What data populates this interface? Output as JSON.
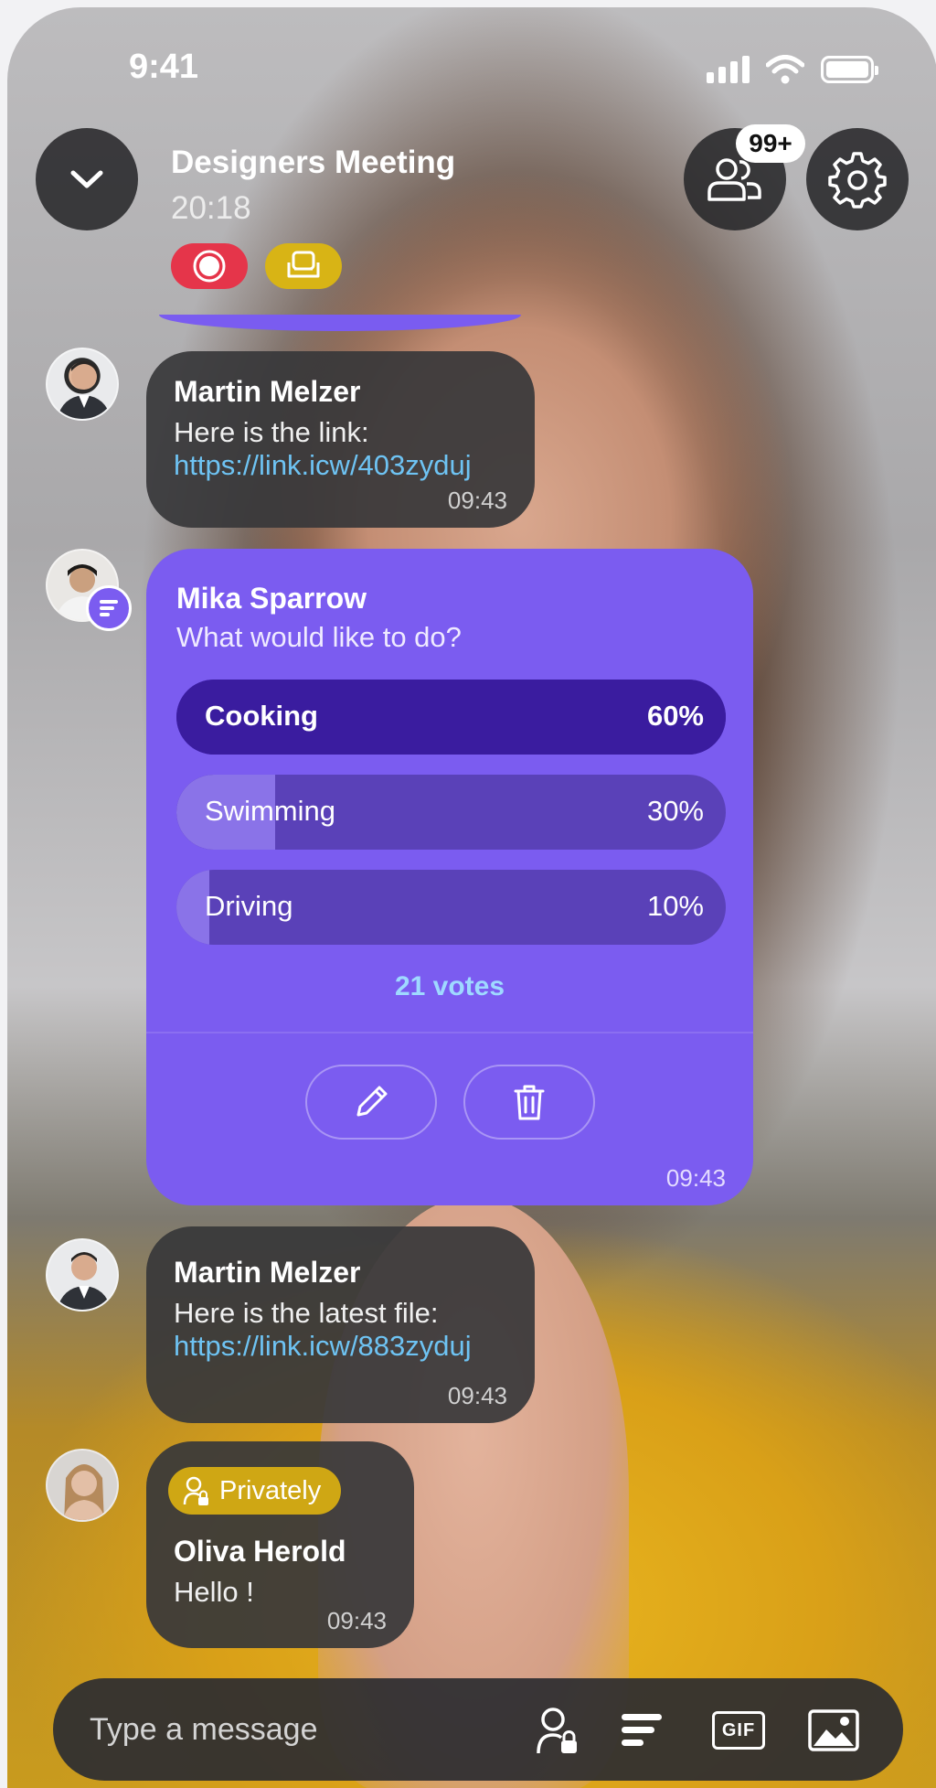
{
  "status": {
    "time": "9:41"
  },
  "header": {
    "title": "Designers Meeting",
    "elapsed": "20:18",
    "participants_badge": "99+"
  },
  "messages": [
    {
      "sender": "Martin Melzer",
      "text": "Here is the link:",
      "link": "https://link.icw/403zyduj",
      "time": "09:43"
    },
    {
      "sender": "Martin Melzer",
      "text": "Here is the latest file:",
      "link": "https://link.icw/883zyduj",
      "time": "09:43"
    },
    {
      "sender": "Oliva Herold",
      "private_label": "Privately",
      "text": "Hello !",
      "time": "09:43"
    }
  ],
  "poll": {
    "sender": "Mika Sparrow",
    "question": "What would like to do?",
    "options": [
      {
        "label": "Cooking",
        "percent_text": "60%",
        "percent": 60
      },
      {
        "label": "Swimming",
        "percent_text": "30%",
        "percent": 30
      },
      {
        "label": "Driving",
        "percent_text": "10%",
        "percent": 10
      }
    ],
    "votes": "21 votes",
    "time": "09:43"
  },
  "composer": {
    "placeholder": "Type a message"
  },
  "icons": [
    "chevron-down-icon",
    "participants-icon",
    "gear-icon",
    "record-icon",
    "seat-icon",
    "poll-icon",
    "pencil-icon",
    "trash-icon",
    "private-user-icon",
    "gif-icon",
    "image-icon"
  ],
  "colors": {
    "accent": "#7b5cf0",
    "record": "#e5354a",
    "private": "#cfa714",
    "link": "#6ec3f3"
  }
}
